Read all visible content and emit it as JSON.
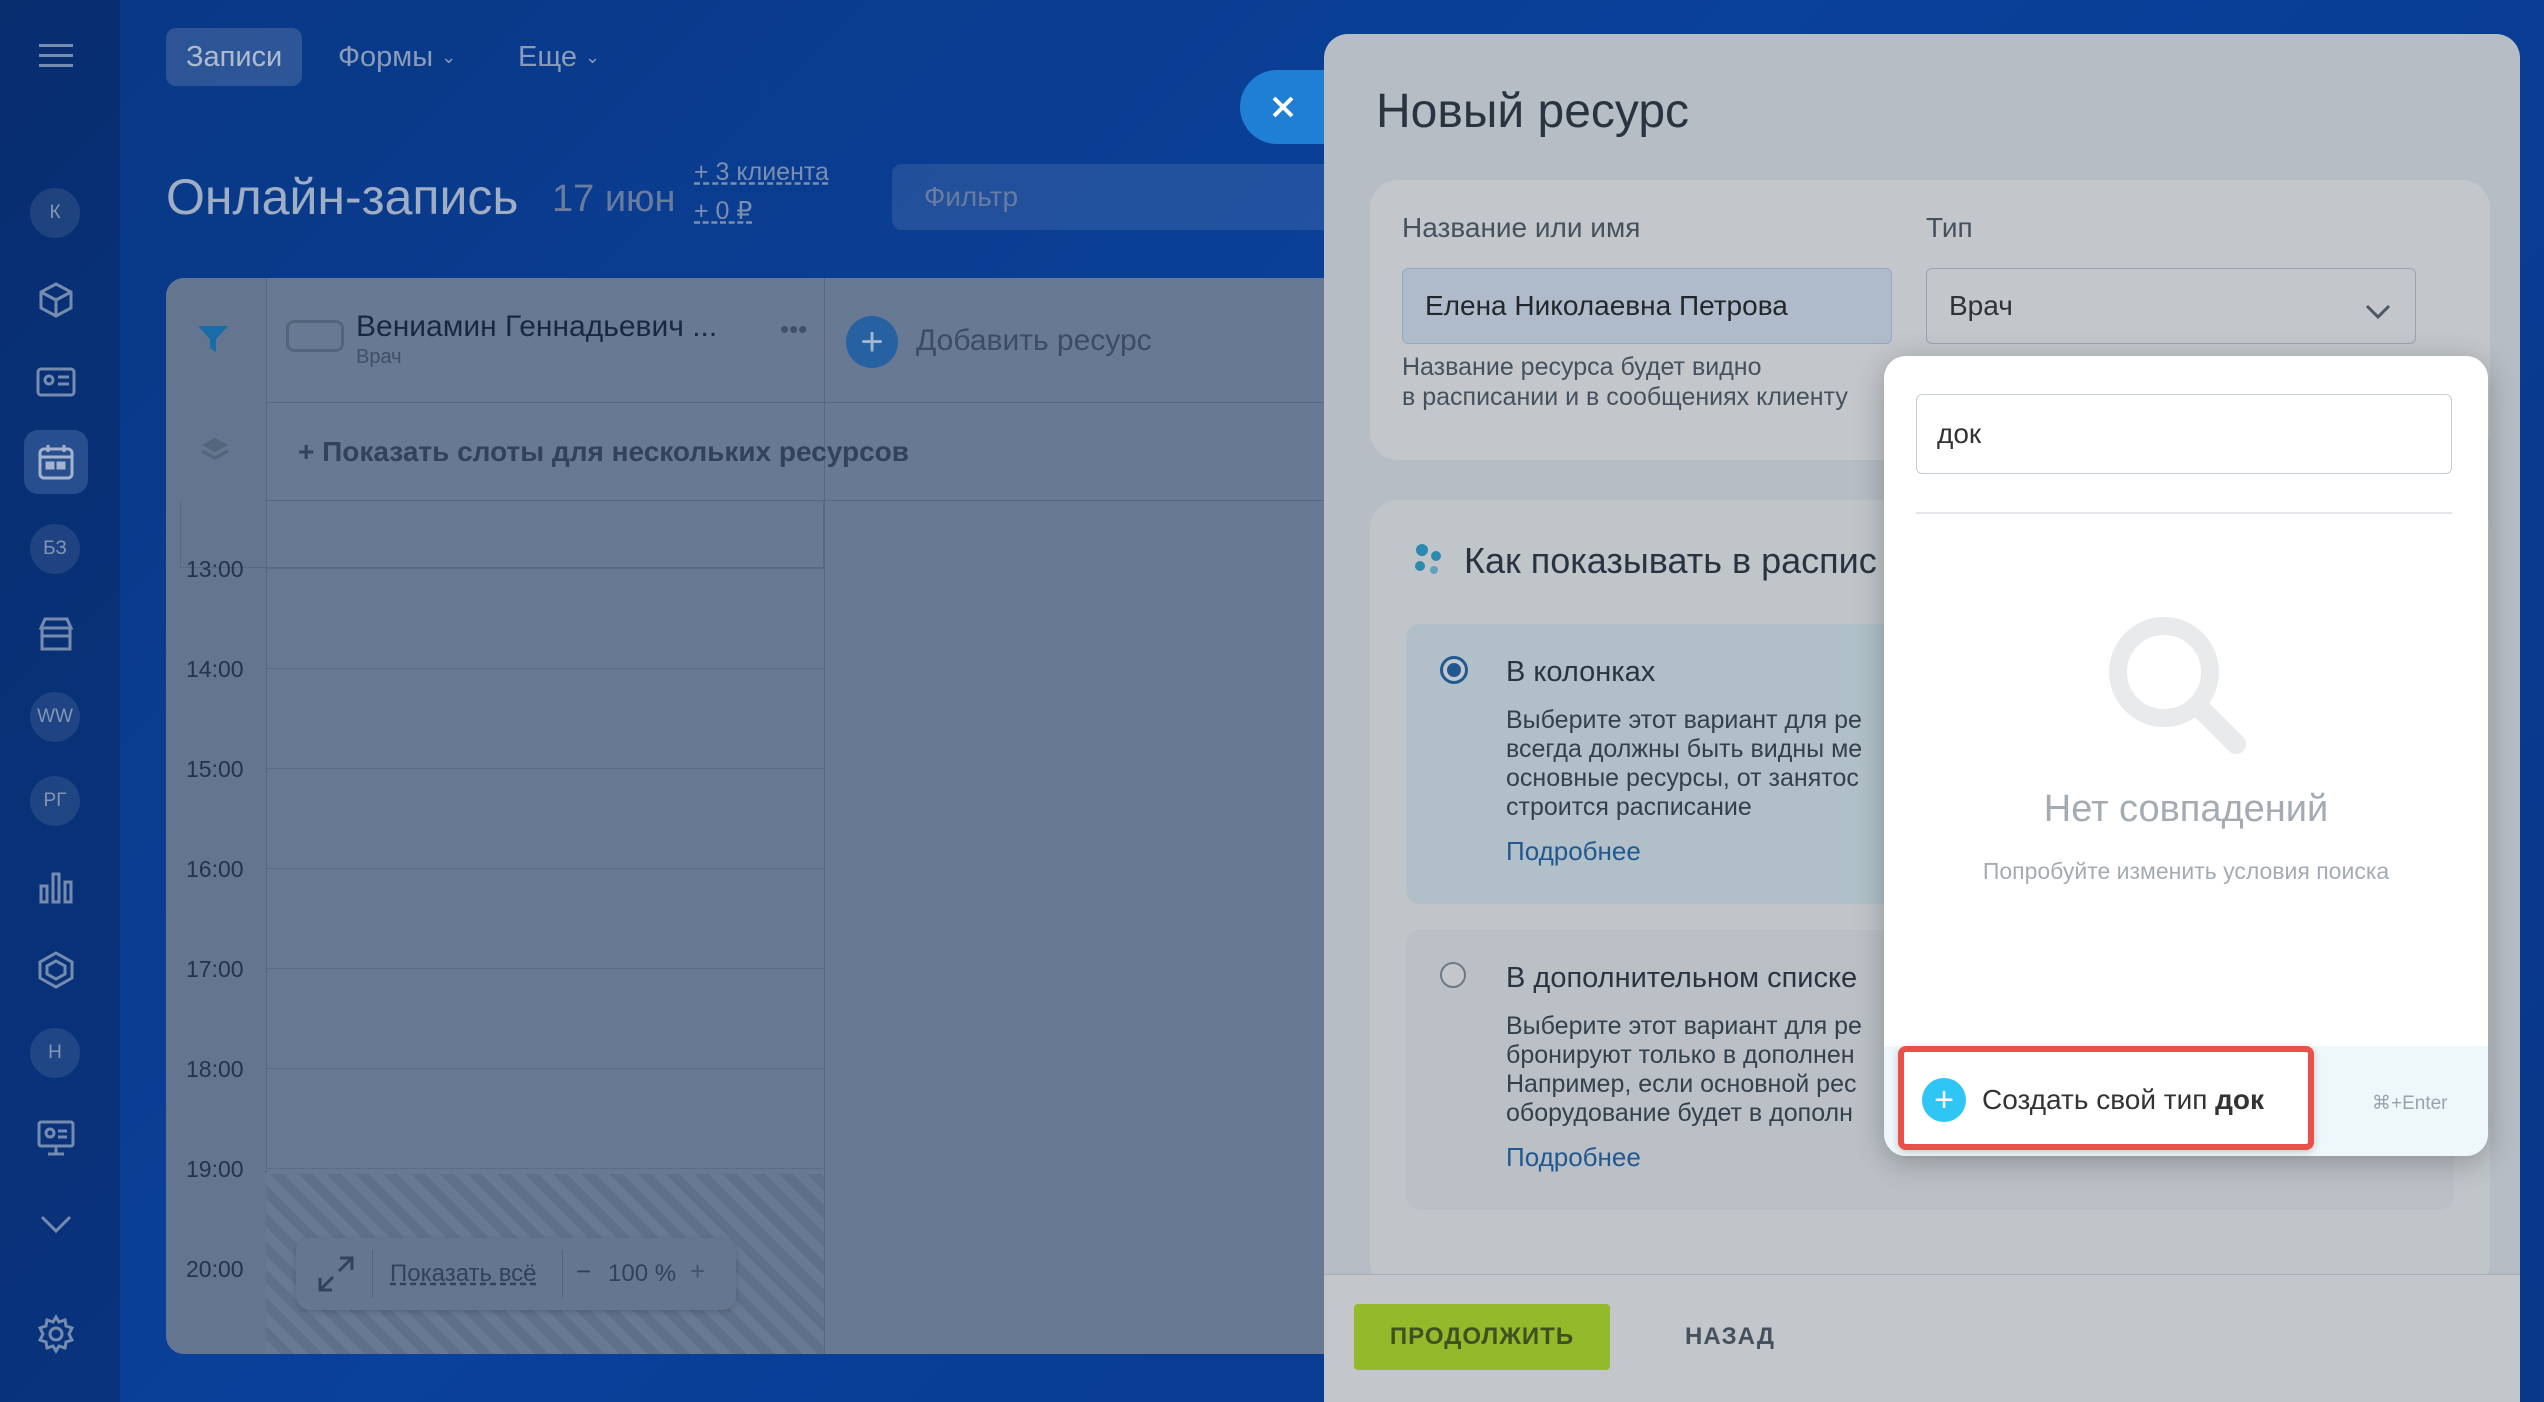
{
  "nav": {
    "menu_icon": "hamburger-icon",
    "tabs": [
      "Записи",
      "Формы",
      "Еще"
    ]
  },
  "rail": {
    "circles": [
      "К",
      "БЗ",
      "WW",
      "РГ",
      "Н"
    ],
    "icons": [
      "cube-icon",
      "contact-card-icon",
      "calendar-icon",
      "store-icon",
      "bar-chart-icon",
      "hexagon-icon",
      "presentation-icon",
      "chevron-down-icon",
      "gear-icon"
    ]
  },
  "header": {
    "title": "Онлайн-запись",
    "date": "17 июн",
    "clients": "+ 3 клиента",
    "money": "+ 0 ₽",
    "filter_placeholder": "Фильтр"
  },
  "calendar": {
    "resource_name": "Вениамин Геннадьевич ...",
    "resource_type": "Врач",
    "add_resource": "Добавить ресурс",
    "show_slots": "+ Показать слоты для нескольких ресурсов",
    "times": [
      "13:00",
      "14:00",
      "15:00",
      "16:00",
      "17:00",
      "18:00",
      "19:00",
      "20:00"
    ],
    "show_all": "Показать всё",
    "zoom": "100 %"
  },
  "slider": {
    "title": "Новый ресурс",
    "name_label": "Название или имя",
    "name_value": "Елена Николаевна Петрова",
    "name_hint_1": "Название ресурса будет видно",
    "name_hint_2": "в расписании и в сообщениях клиенту",
    "type_label": "Тип",
    "type_value": "Врач",
    "display_title": "Как показывать в распис",
    "option1_title": "В колонках",
    "option1_lines": [
      "Выберите этот вариант для ре",
      "всегда должны быть видны ме",
      "основные ресурсы, от занятос",
      "строится расписание"
    ],
    "option2_title": "В дополнительном списке",
    "option2_lines": [
      "Выберите этот вариант для ре",
      "бронируют только в дополнен",
      "Например, если основной рес",
      "оборудование будет в дополн"
    ],
    "more_link": "Подробнее",
    "continue": "ПРОДОЛЖИТЬ",
    "back": "НАЗАД"
  },
  "dropdown": {
    "search_value": "док",
    "empty_title": "Нет совпадений",
    "empty_hint": "Попробуйте изменить условия поиска",
    "create_prefix": "Создать свой тип ",
    "create_term": "док",
    "shortcut": "⌘+Enter"
  },
  "colors": {
    "accent": "#2fc6f6",
    "continue": "#bbed21",
    "highlight": "#ea4f49",
    "selected_option": "#e6f6fb"
  }
}
